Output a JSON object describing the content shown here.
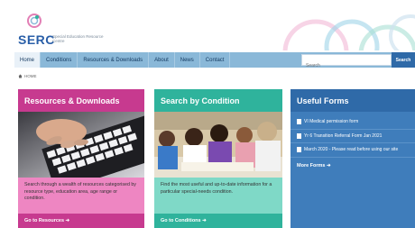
{
  "header": {
    "logo_text": "SERC",
    "logo_subtitle": "Special Education Resource Centre"
  },
  "nav": {
    "items": [
      "Home",
      "Conditions",
      "Resources & Downloads",
      "About",
      "News",
      "Contact"
    ],
    "search_placeholder": "Search",
    "search_button": "Search"
  },
  "breadcrumb": {
    "home": "HOME"
  },
  "panels": {
    "resources": {
      "title": "Resources & Downloads",
      "description": "Search through a wealth of resources categorised by resource type, education area, age range or condition.",
      "link": "Go to Resources ➜"
    },
    "conditions": {
      "title": "Search by Condition",
      "description": "Find the most useful and up-to-date information for a particular special-needs condition.",
      "link": "Go to Conditions ➜"
    },
    "forms": {
      "title": "Useful Forms",
      "items": [
        "VI Medical permission form",
        "Yr 6 Transition Referral Form Jan 2021",
        "March 2020 - Please read before using our site"
      ],
      "more": "More Forms ➜"
    }
  },
  "colors": {
    "pink": "#c73a8f",
    "teal": "#2fb39c",
    "blue": "#2f6aa8",
    "nav": "#8ab8d8"
  }
}
